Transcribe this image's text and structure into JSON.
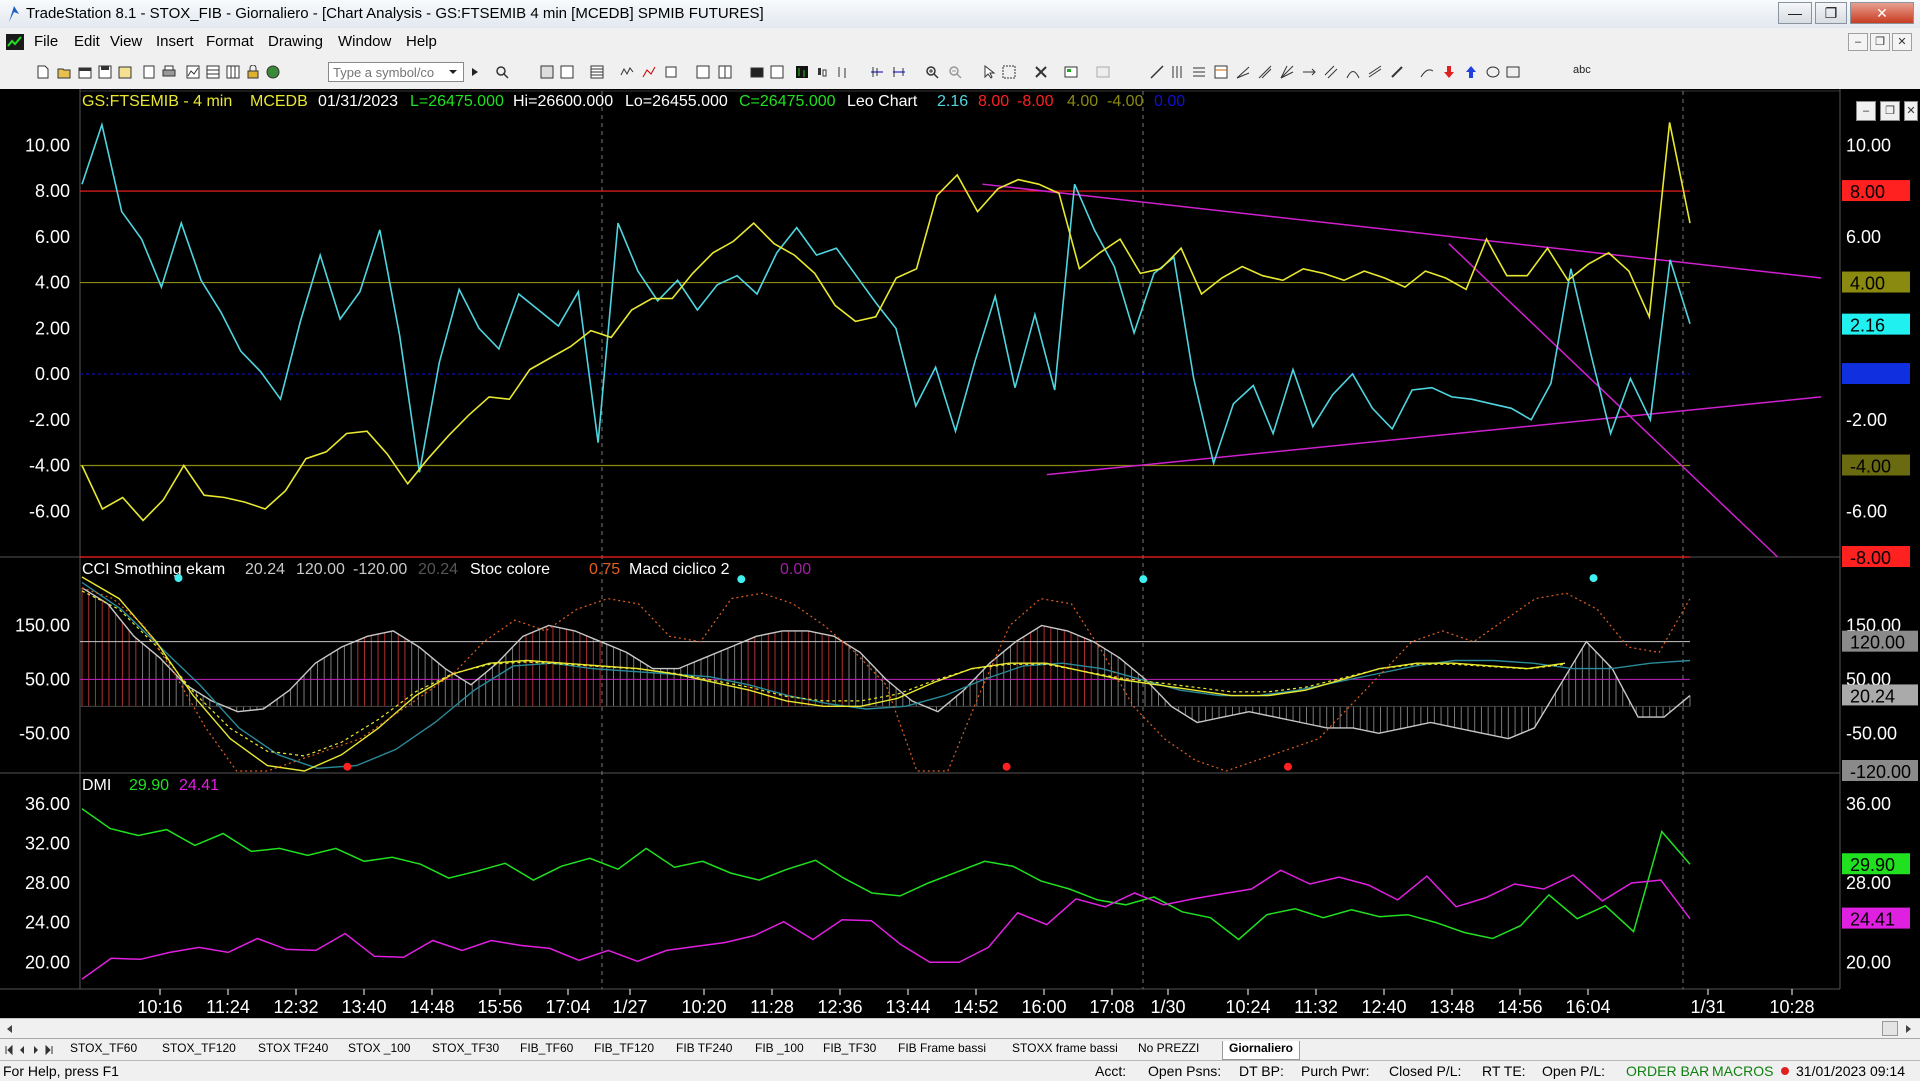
{
  "window": {
    "title": "TradeStation 8.1 - STOX_FIB - Giornaliero - [Chart Analysis - GS:FTSEMIB  4 min  [MCEDB] SPMIB FUTURES]",
    "minimize_label": "—",
    "maximize_label": "❐",
    "close_label": "✕"
  },
  "menu": {
    "items": [
      "File",
      "Edit",
      "View",
      "Insert",
      "Format",
      "Drawing",
      "Window",
      "Help"
    ]
  },
  "toolbar": {
    "symbol_placeholder": "Type a symbol/co",
    "text_tool_label": "abc"
  },
  "colors": {
    "cyan": "#4fd5e0",
    "yellow": "#e8e830",
    "magenta": "#d020d0",
    "red": "#ff2020",
    "olive": "#8a8a10",
    "green": "#20e020",
    "grey": "#c8c8c8",
    "navy": "#1010a0"
  },
  "price_pane": {
    "header": {
      "symbol": "GS:FTSEMIB - 4 min",
      "feed": "MCEDB",
      "date": "01/31/2023",
      "last": "L=26475.000",
      "high": "Hi=26600.000",
      "low": "Lo=26455.000",
      "close": "C=26475.000",
      "indicator": "Leo Chart",
      "v1": "2.16",
      "v2": "8.00",
      "v3": "-8.00",
      "v4": "4.00",
      "v5": "-4.00",
      "v6": "0.00"
    },
    "y_ticks": [
      "10.00",
      "8.00",
      "6.00",
      "4.00",
      "2.00",
      "0.00",
      "-2.00",
      "-4.00",
      "-6.00"
    ],
    "right_ticks": [
      "10.00",
      "6.00",
      "-2.00",
      "-6.00"
    ],
    "right_labels": [
      "8.00",
      "4.00",
      "2.16",
      "0.00",
      "-4.00",
      "-8.00"
    ],
    "chart_data": {
      "type": "line",
      "ylim": [
        -8,
        11.5
      ],
      "levels": [
        8,
        4,
        0,
        -4,
        -8
      ],
      "series": [
        {
          "values": [
            8.3,
            10.9,
            7.1,
            5.9,
            3.8,
            6.6,
            4.1,
            2.7,
            1.0,
            0.1,
            -1.1,
            2.3,
            5.2,
            2.4,
            3.6,
            6.3,
            1.7,
            -4.3,
            0.5,
            3.7,
            2.0,
            1.1,
            3.5,
            2.8,
            2.1,
            3.6,
            -3.0,
            6.6,
            4.5,
            3.2,
            4.1,
            2.8,
            3.9,
            4.3,
            3.5,
            5.3,
            6.4,
            5.2,
            5.5,
            4.3,
            3.1,
            2.0,
            -1.4,
            0.3,
            -2.5,
            0.6,
            3.4,
            -0.6,
            2.6,
            -0.7,
            8.3,
            6.3,
            4.7,
            1.8,
            4.4,
            5.1,
            -0.2,
            -3.9,
            -1.3,
            -0.5,
            -2.6,
            0.2,
            -2.3,
            -0.9,
            0.0,
            -1.5,
            -2.4,
            -0.7,
            -0.6,
            -1.0,
            -1.1,
            -1.3,
            -1.5,
            -2.0,
            -0.4,
            4.6,
            0.9,
            -2.6,
            -0.2,
            -2.0,
            5.0,
            2.2
          ]
        },
        {
          "values": [
            -4.0,
            -5.9,
            -5.4,
            -6.4,
            -5.5,
            -4.0,
            -5.3,
            -5.4,
            -5.6,
            -5.9,
            -5.1,
            -3.7,
            -3.4,
            -2.6,
            -2.5,
            -3.5,
            -4.8,
            -3.7,
            -2.7,
            -1.8,
            -1.0,
            -1.1,
            0.2,
            0.7,
            1.2,
            1.9,
            1.6,
            2.8,
            3.3,
            3.3,
            4.4,
            5.3,
            5.8,
            6.6,
            5.7,
            5.2,
            4.4,
            3.0,
            2.3,
            2.5,
            4.2,
            4.6,
            7.8,
            8.7,
            7.1,
            8.1,
            8.5,
            8.3,
            7.9,
            4.6,
            5.3,
            5.9,
            4.4,
            4.6,
            5.5,
            3.5,
            4.2,
            4.7,
            4.3,
            4.1,
            4.6,
            4.4,
            4.1,
            4.5,
            4.2,
            3.8,
            4.5,
            4.2,
            3.7,
            5.9,
            4.3,
            4.3,
            5.5,
            4.1,
            4.8,
            5.3,
            4.5,
            2.5,
            11.0,
            6.6
          ]
        }
      ],
      "trendlines": [
        {
          "from": [
            0.56,
            8.3
          ],
          "to": [
            0.995,
            4.2
          ]
        },
        {
          "from": [
            0.6,
            -4.4
          ],
          "to": [
            0.995,
            -1.0
          ]
        },
        {
          "from": [
            0.85,
            5.7
          ],
          "to": [
            0.97,
            -8.0
          ]
        }
      ]
    }
  },
  "cci_pane": {
    "header": {
      "name": "CCI Smothing ekam",
      "v1": "20.24",
      "v2": "120.00",
      "v3": "-120.00",
      "v4": "20.24",
      "name2": "Stoc colore",
      "v5": "0.75",
      "name3": "Macd ciclico 2",
      "v6": "0.00"
    },
    "y_ticks": [
      "150.00",
      "50.00",
      "-50.00"
    ],
    "right_ticks": [
      "150.00",
      "50.00",
      "-50.00"
    ],
    "right_labels": [
      "120.00",
      "20.24",
      "-120.00"
    ],
    "chart_data": {
      "type": "line",
      "ylim": [
        -120,
        240
      ],
      "levels": [
        120,
        50,
        0
      ],
      "series": [
        {
          "values": [
            220,
            190,
            130,
            90,
            40,
            10,
            -10,
            -5,
            30,
            80,
            110,
            130,
            140,
            110,
            70,
            40,
            80,
            130,
            150,
            140,
            120,
            100,
            70,
            70,
            90,
            110,
            130,
            140,
            140,
            130,
            100,
            50,
            10,
            -10,
            30,
            80,
            120,
            150,
            140,
            120,
            90,
            50,
            0,
            -30,
            -20,
            -10,
            -20,
            -30,
            -40,
            -40,
            -50,
            -40,
            -30,
            -40,
            -50,
            -60,
            -40,
            40,
            120,
            70,
            -20,
            -20,
            20
          ]
        },
        {
          "values": [
            230,
            180,
            110,
            40,
            -40,
            -90,
            -115,
            -110,
            -80,
            -30,
            30,
            75,
            80,
            70,
            65,
            60,
            55,
            40,
            20,
            5,
            -5,
            0,
            20,
            50,
            75,
            80,
            70,
            50,
            30,
            20,
            20,
            30,
            45,
            60,
            75,
            85,
            85,
            80,
            70,
            70,
            80,
            85
          ]
        },
        {
          "values": [
            240,
            200,
            120,
            20,
            -60,
            -110,
            -120,
            -90,
            -40,
            20,
            60,
            80,
            85,
            80,
            75,
            70,
            60,
            45,
            30,
            10,
            0,
            0,
            15,
            45,
            70,
            80,
            80,
            65,
            50,
            40,
            30,
            20,
            20,
            30,
            50,
            70,
            80,
            80,
            75,
            70,
            80
          ]
        },
        {
          "values": [
            220,
            200,
            150,
            60,
            -40,
            -120,
            -120,
            -100,
            -80,
            -60,
            -20,
            20,
            60,
            120,
            160,
            140,
            180,
            200,
            190,
            130,
            120,
            200,
            210,
            190,
            150,
            100,
            40,
            -120,
            -120,
            20,
            150,
            200,
            190,
            100,
            0,
            -60,
            -100,
            -120,
            -100,
            -80,
            -60,
            0,
            60,
            120,
            140,
            120,
            160,
            200,
            210,
            180,
            110,
            100,
            200
          ]
        }
      ],
      "markers": [
        {
          "x": 0.06,
          "y": 238,
          "kind": "cyan"
        },
        {
          "x": 0.41,
          "y": 236,
          "kind": "cyan"
        },
        {
          "x": 0.66,
          "y": 236,
          "kind": "cyan"
        },
        {
          "x": 0.94,
          "y": 238,
          "kind": "cyan"
        },
        {
          "x": 0.165,
          "y": -112,
          "kind": "red"
        },
        {
          "x": 0.575,
          "y": -112,
          "kind": "red"
        },
        {
          "x": 0.75,
          "y": -112,
          "kind": "red"
        }
      ]
    }
  },
  "dmi_pane": {
    "header": {
      "name": "DMI",
      "v1": "29.90",
      "v2": "24.41"
    },
    "y_ticks": [
      "36.00",
      "32.00",
      "28.00",
      "24.00",
      "20.00"
    ],
    "right_ticks": [
      "36.00",
      "28.00",
      "20.00"
    ],
    "right_labels": [
      "29.90",
      "24.41"
    ],
    "chart_data": {
      "type": "line",
      "ylim": [
        17.5,
        37.5
      ],
      "series": [
        {
          "values": [
            35.5,
            33.5,
            32.8,
            33.4,
            31.8,
            33.0,
            31.2,
            31.5,
            30.8,
            31.5,
            30.2,
            30.6,
            29.9,
            28.5,
            29.2,
            30.0,
            28.3,
            29.7,
            30.5,
            29.4,
            31.5,
            29.6,
            30.2,
            29.0,
            28.3,
            29.4,
            30.3,
            28.5,
            27.0,
            26.7,
            28.0,
            29.1,
            30.2,
            29.7,
            28.2,
            27.4,
            26.3,
            25.8,
            26.6,
            25.1,
            24.5,
            22.3,
            24.8,
            25.4,
            24.5,
            25.3,
            24.6,
            24.8,
            24.0,
            23.0,
            22.4,
            23.7,
            26.8,
            24.4,
            25.7,
            23.1,
            33.2,
            29.9
          ]
        },
        {
          "values": [
            18.3,
            20.4,
            20.3,
            21.0,
            21.5,
            21.0,
            22.4,
            21.3,
            21.2,
            22.9,
            20.6,
            20.5,
            22.2,
            21.2,
            22.2,
            21.7,
            21.4,
            20.2,
            21.2,
            20.1,
            21.2,
            21.6,
            22.0,
            22.7,
            24.1,
            22.3,
            24.3,
            24.2,
            21.8,
            20.0,
            20.0,
            21.5,
            25.0,
            23.8,
            26.4,
            25.6,
            27.0,
            25.8,
            26.4,
            26.9,
            27.4,
            29.3,
            27.9,
            28.6,
            27.8,
            26.3,
            28.7,
            25.6,
            26.5,
            27.9,
            27.4,
            28.8,
            26.2,
            28.0,
            28.3,
            24.4
          ]
        }
      ]
    }
  },
  "x_axis": {
    "labels": [
      "10:16",
      "11:24",
      "12:32",
      "13:40",
      "14:48",
      "15:56",
      "17:04",
      "1/27",
      "10:20",
      "11:28",
      "12:36",
      "13:44",
      "14:52",
      "16:00",
      "17:08",
      "1/30",
      "10:24",
      "11:32",
      "12:40",
      "13:48",
      "14:56",
      "16:04",
      "1/31",
      "10:28"
    ],
    "session_breaks": [
      "1/27",
      "1/30",
      "1/31"
    ]
  },
  "tabs": [
    "STOX_TF60",
    "STOX_TF120",
    "STOX TF240",
    "STOX _100",
    "STOX_TF30",
    "FIB_TF60",
    "FIB_TF120",
    "FIB TF240",
    "FIB _100",
    "FIB_TF30",
    "FIB Frame bassi",
    "STOXX frame bassi",
    "No PREZZI",
    "Giornaliero"
  ],
  "active_tab": "Giornaliero",
  "status": {
    "help": "For Help, press F1",
    "acct": "Acct:",
    "open_psns": "Open Psns:",
    "dt_bp": "DT BP:",
    "purch_pwr": "Purch Pwr:",
    "closed_pl": "Closed P/L:",
    "rt_te": "RT TE:",
    "open_pl": "Open P/L:",
    "order_bar": "ORDER BAR",
    "macros": "MACROS",
    "datetime": "31/01/2023 09:14"
  }
}
